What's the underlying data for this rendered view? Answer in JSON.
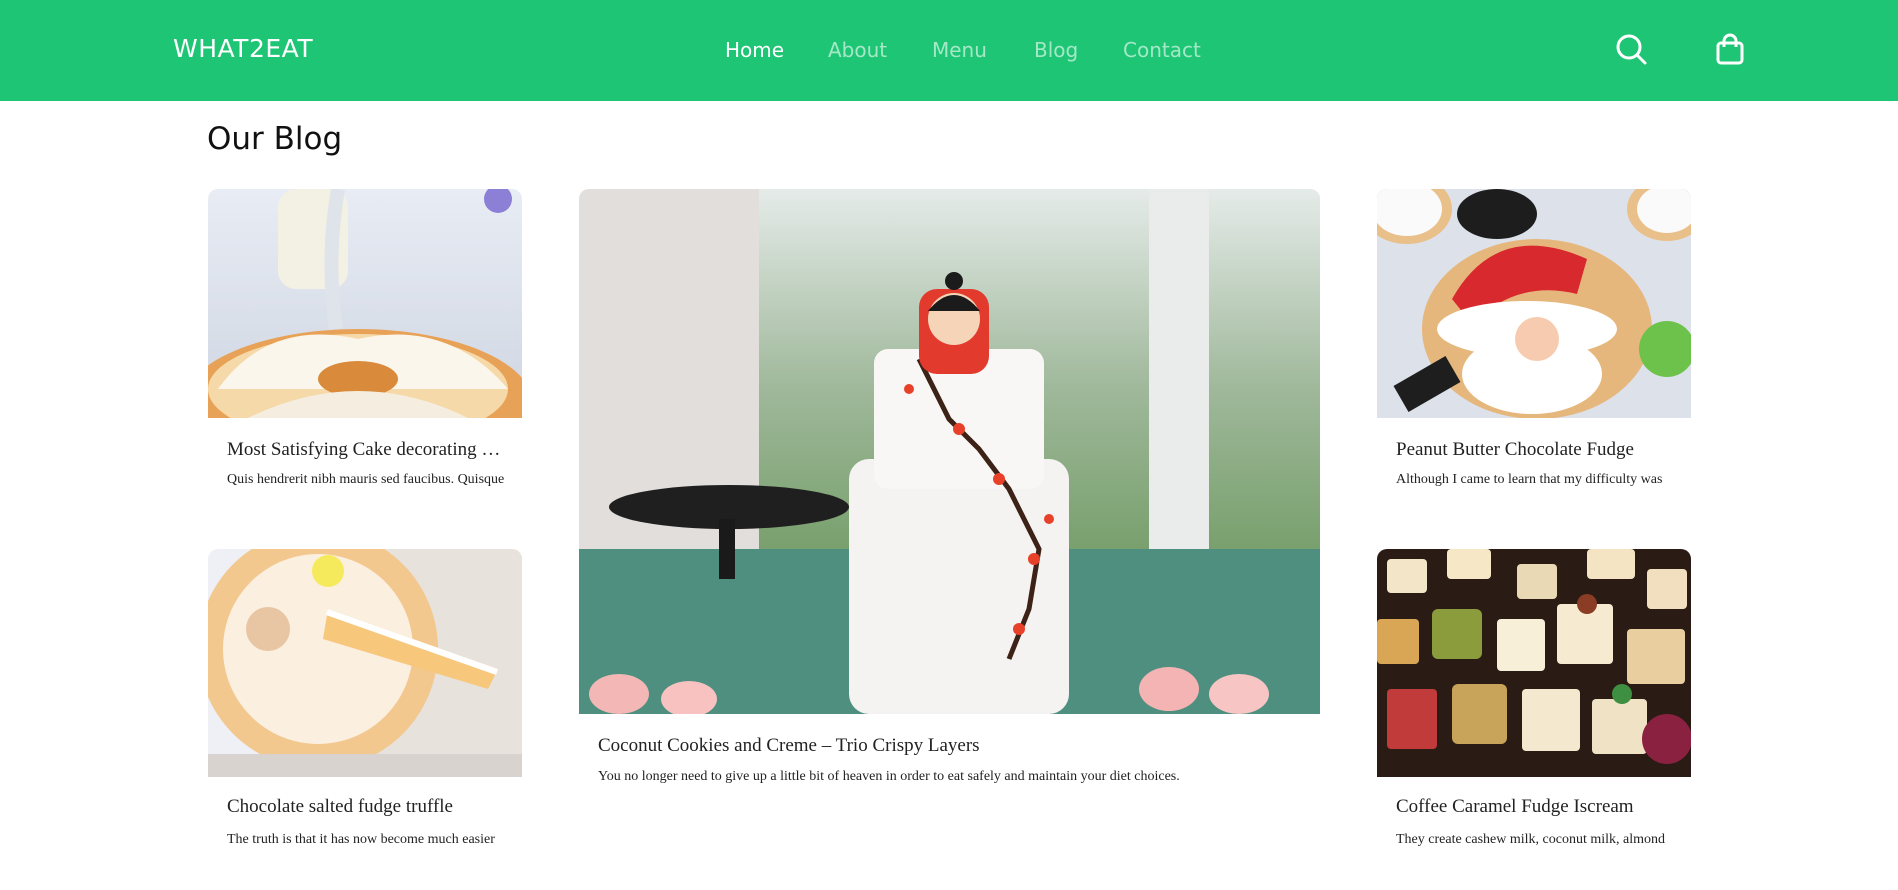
{
  "brand": "WHAT2EAT",
  "nav": [
    {
      "label": "Home",
      "active": true
    },
    {
      "label": "About",
      "active": false
    },
    {
      "label": "Menu",
      "active": false
    },
    {
      "label": "Blog",
      "active": false
    },
    {
      "label": "Contact",
      "active": false
    }
  ],
  "header_icons": [
    "search-icon",
    "shopping-bag-icon"
  ],
  "colors": {
    "accent": "#1dc574",
    "text": "#111111"
  },
  "page_title": "Our Blog",
  "posts": [
    {
      "title": "Most Satisfying Cake decorating Ideas",
      "excerpt": "Quis hendrerit nibh mauris sed faucibus. Quisque",
      "image": "bundt-cake-with-glaze-photo"
    },
    {
      "title": "Chocolate salted fudge truffle",
      "excerpt": "The truth is that it has now become much easier",
      "image": "sliced-bundt-cake-photo"
    },
    {
      "title": "Coconut Cookies and Creme – Trio Crispy Layers",
      "excerpt": "You no longer need to give up a little bit of heaven in order to eat safely and maintain your diet choices.",
      "image": "tiered-wedding-cake-with-doll-photo"
    },
    {
      "title": "Peanut Butter Chocolate Fudge",
      "excerpt": "Although I came to learn that my difficulty was",
      "image": "christmas-santa-cookies-photo"
    },
    {
      "title": "Coffee Caramel Fudge Iscream",
      "excerpt": "They create cashew milk, coconut milk, almond",
      "image": "assorted-petit-fours-photo"
    }
  ]
}
